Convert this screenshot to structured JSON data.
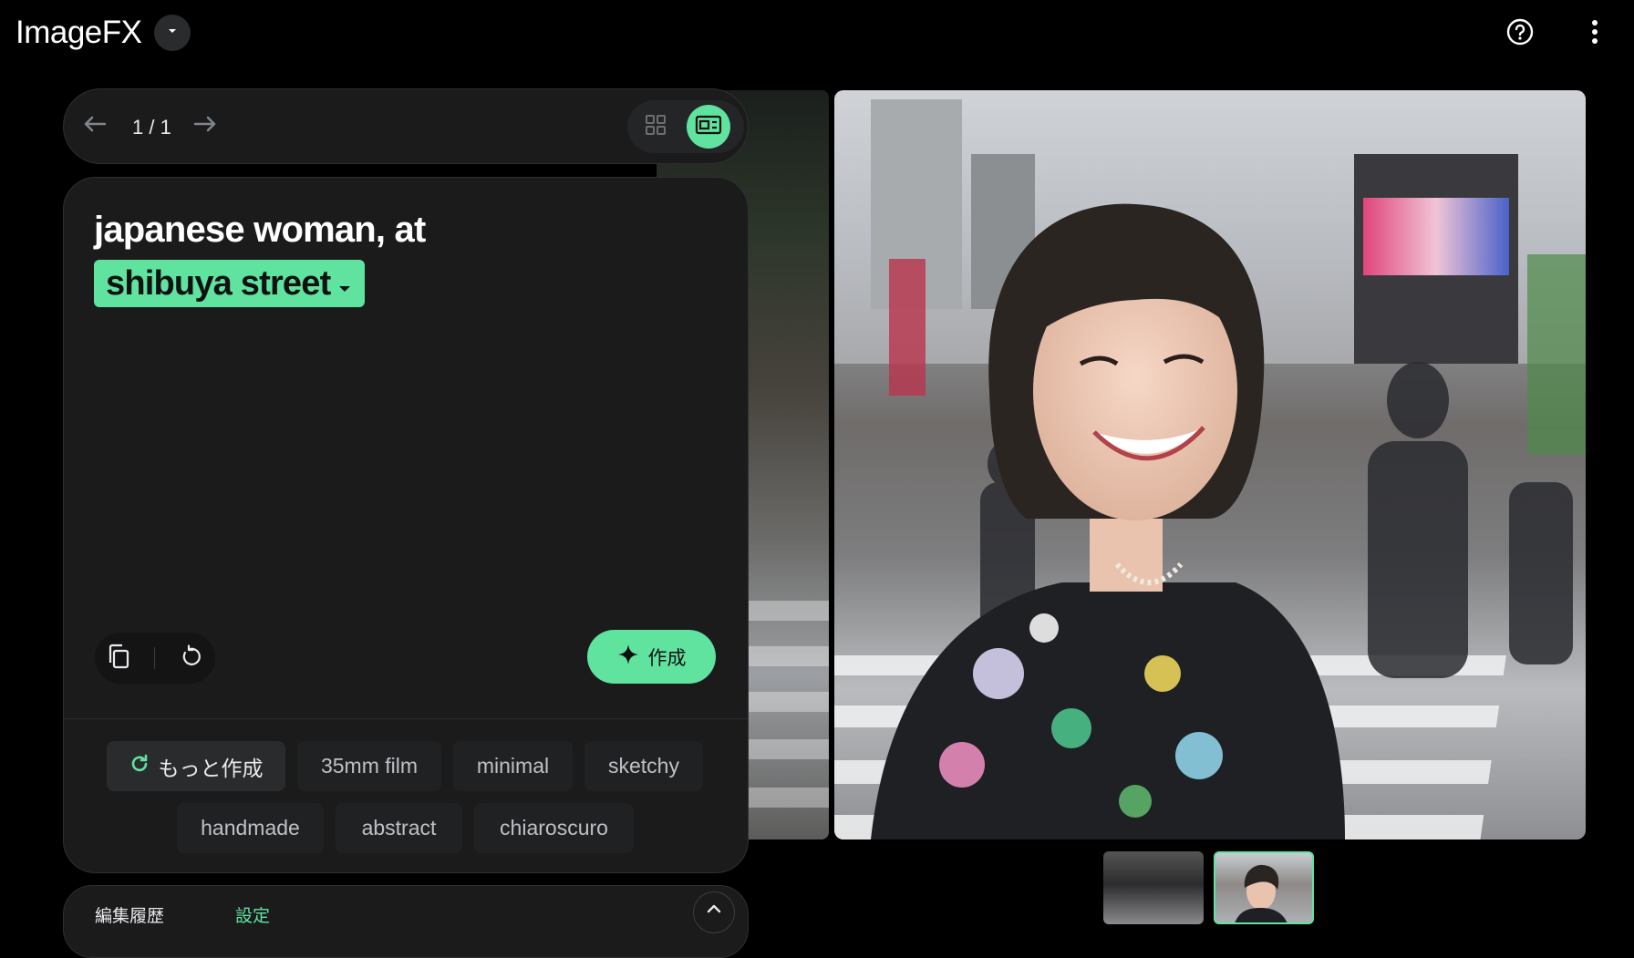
{
  "header": {
    "app_title": "ImageFX",
    "help_icon": "help-circle-icon",
    "menu_icon": "more-vert-icon"
  },
  "nav": {
    "counter": "1 / 1"
  },
  "prompt": {
    "text": "japanese woman, at",
    "chip": "shibuya street"
  },
  "actions": {
    "create_label": "作成"
  },
  "suggestions": {
    "more_label": "もっと作成",
    "chips": [
      "35mm film",
      "minimal",
      "sketchy",
      "handmade",
      "abstract",
      "chiaroscuro"
    ]
  },
  "bottom_tabs": [
    "編集履歴",
    "設定"
  ],
  "colors": {
    "accent": "#5fe39f",
    "panel": "#1b1b1c",
    "background": "#000000"
  }
}
